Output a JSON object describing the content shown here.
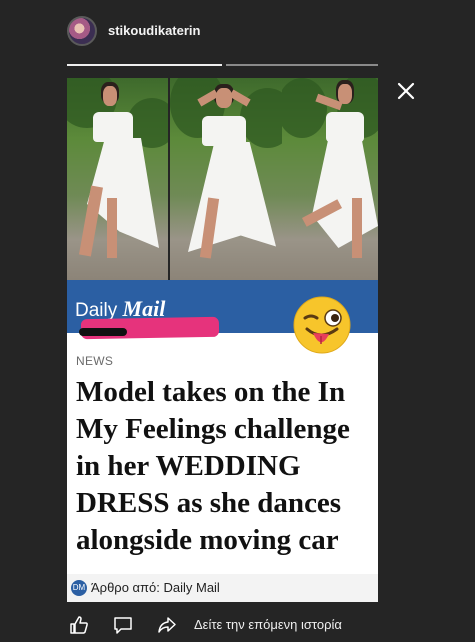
{
  "header": {
    "username": "stikoudikaterin"
  },
  "article": {
    "publisher_logo_light": "Daily",
    "publisher_logo_bold": "Mail",
    "section": "NEWS",
    "headline": "Model takes on the In My Feelings challenge in her WEDDING DRESS as she dances alongside moving car",
    "source_label": "Άρθρο από: Daily Mail",
    "source_icon_text": "DM"
  },
  "footer": {
    "next_story_label": "Δείτε την επόμενη ιστορία"
  },
  "icons": {
    "close": "close-icon",
    "like": "thumbs-up-icon",
    "comment": "comment-icon",
    "share": "share-icon",
    "emoji": "winking-tongue-emoji"
  },
  "colors": {
    "background": "#252525",
    "daily_mail_blue": "#2b5fa3",
    "redaction_pink": "#e6337c"
  }
}
